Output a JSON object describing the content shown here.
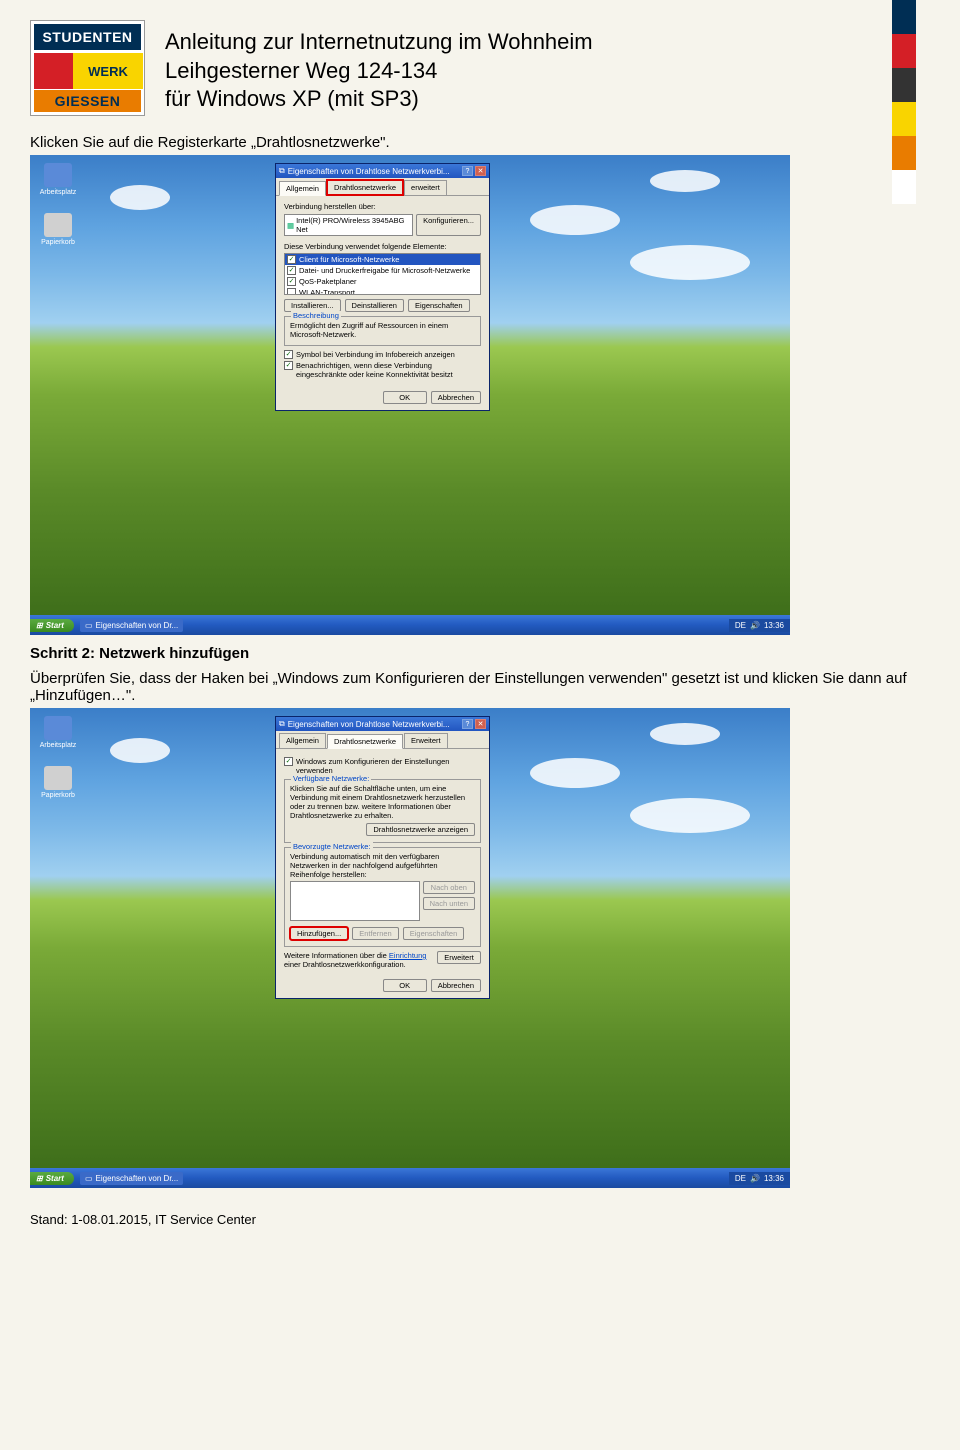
{
  "header": {
    "logo_top": "STUDENTEN",
    "logo_mid": "WERK",
    "logo_bot": "GIESSEN",
    "title1": "Anleitung zur Internetnutzung im Wohnheim",
    "title2": "Leihgesterner Weg 124-134",
    "title3": "für Windows XP (mit SP3)"
  },
  "stripes": [
    "#002e54",
    "#d41f26",
    "#333333",
    "#f9d400",
    "#e97c00",
    "#ffffff"
  ],
  "intro": "Klicken Sie auf die Registerkarte „Drahtlosnetzwerke\".",
  "shot1": {
    "desktop_icons": [
      {
        "label": "Arbeitsplatz",
        "bg": "#5a8ad8"
      },
      {
        "label": "Papierkorb",
        "bg": "#d0d0d0"
      }
    ],
    "dialog_title": "Eigenschaften von Drahtlose Netzwerkverbi...",
    "tabs": [
      "Allgemein",
      "Drahtlosnetzwerke",
      "erweitert"
    ],
    "tab_highlight_index": 1,
    "connect_label": "Verbindung herstellen über:",
    "adapter": "Intel(R) PRO/Wireless 3945ABG Net",
    "configure": "Konfigurieren...",
    "elements_label": "Diese Verbindung verwendet folgende Elemente:",
    "elements": [
      {
        "checked": true,
        "label": "Client für Microsoft-Netzwerke",
        "selected": true
      },
      {
        "checked": true,
        "label": "Datei- und Druckerfreigabe für Microsoft-Netzwerke"
      },
      {
        "checked": true,
        "label": "QoS-Paketplaner"
      },
      {
        "checked": false,
        "label": "WLAN-Transport"
      }
    ],
    "install": "Installieren...",
    "uninstall": "Deinstallieren",
    "props": "Eigenschaften",
    "desc_legend": "Beschreibung",
    "desc_text": "Ermöglicht den Zugriff auf Ressourcen in einem Microsoft-Netzwerk.",
    "chk1": "Symbol bei Verbindung im Infobereich anzeigen",
    "chk2": "Benachrichtigen, wenn diese Verbindung eingeschränkte oder keine Konnektivität besitzt",
    "ok": "OK",
    "cancel": "Abbrechen",
    "start": "Start",
    "task": "Eigenschaften von Dr...",
    "lang": "DE",
    "time": "13:36"
  },
  "step2": {
    "heading": "Schritt 2: Netzwerk hinzufügen",
    "text": "Überprüfen Sie, dass der Haken bei „Windows zum Konfigurieren der Einstellungen verwenden\" gesetzt ist und klicken Sie dann auf „Hinzufügen…\"."
  },
  "shot2": {
    "dialog_title": "Eigenschaften von Drahtlose Netzwerkverbi...",
    "tabs": [
      "Allgemein",
      "Drahtlosnetzwerke",
      "Erweitert"
    ],
    "tab_sel_index": 1,
    "chk_win": "Windows zum Konfigurieren der Einstellungen verwenden",
    "avail_legend": "Verfügbare Netzwerke:",
    "avail_text": "Klicken Sie auf die Schaltfläche unten, um eine Verbindung mit einem Drahtlosnetzwerk herzustellen oder zu trennen bzw. weitere Informationen über Drahtlosnetzwerke zu erhalten.",
    "show_nets": "Drahtlosnetzwerke anzeigen",
    "pref_legend": "Bevorzugte Netzwerke:",
    "pref_text": "Verbindung automatisch mit den verfügbaren Netzwerken in der nachfolgend aufgeführten Reihenfolge herstellen:",
    "up": "Nach oben",
    "down": "Nach unten",
    "add": "Hinzufügen...",
    "remove": "Entfernen",
    "props": "Eigenschaften",
    "info_text": "Weitere Informationen über die Einrichtung einer Drahtlosnetzwerkkonfiguration.",
    "info_link": "Einrichtung",
    "extended": "Erweitert",
    "ok": "OK",
    "cancel": "Abbrechen",
    "start": "Start",
    "task": "Eigenschaften von Dr...",
    "lang": "DE",
    "time": "13:36"
  },
  "footer": "Stand: 1-08.01.2015, IT Service Center"
}
